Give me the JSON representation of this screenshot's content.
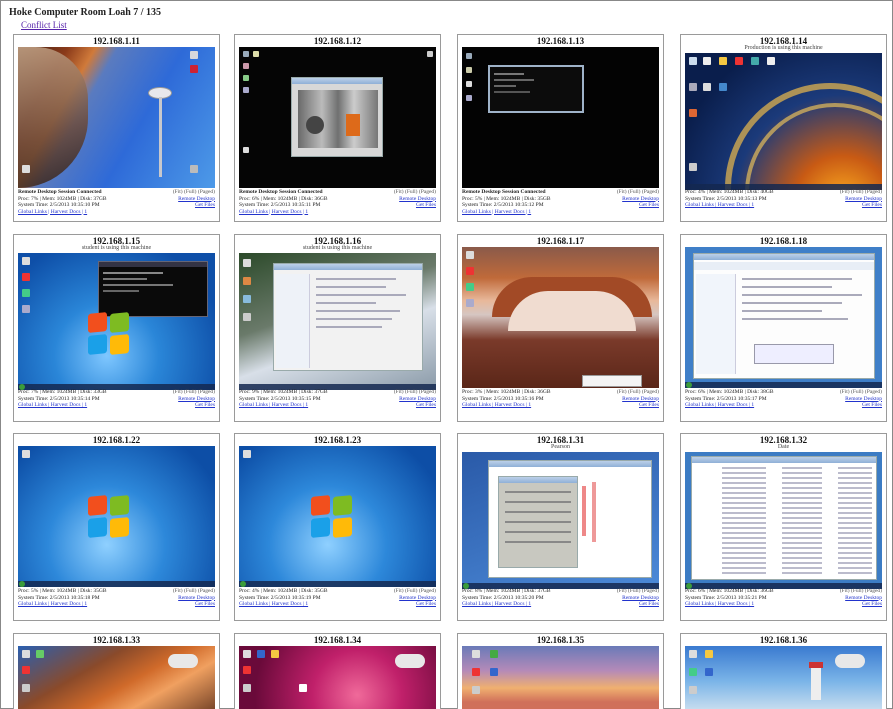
{
  "page": {
    "title": "Hoke Computer Room Loah 7 / 135",
    "link": "Conflict List"
  },
  "common": {
    "remote_link": "Remote Desktop",
    "files_link": "Get Files",
    "dim_line": "(Fit) (Full) (Paged)"
  },
  "cards": [
    {
      "ip": "192.168.1.11",
      "sub": "",
      "line1": "Remote Desktop Session Connected",
      "line2": "Proc: 7% | Mem: 1024MB | Disk: 37GB",
      "line3": "System Time: 2/5/2013 10:35:10 PM",
      "line4": "Global Links | Harvest Docs | 1"
    },
    {
      "ip": "192.168.1.12",
      "sub": "",
      "line1": "Remote Desktop Session Connected",
      "line2": "Proc: 6% | Mem: 1024MB | Disk: 36GB",
      "line3": "System Time: 2/5/2013 10:35:11 PM",
      "line4": "Global Links | Harvest Docs | 1"
    },
    {
      "ip": "192.168.1.13",
      "sub": "",
      "line1": "Remote Desktop Session Connected",
      "line2": "Proc: 5% | Mem: 1024MB | Disk: 35GB",
      "line3": "System Time: 2/5/2013 10:35:12 PM",
      "line4": "Global Links | Harvest Docs | 1"
    },
    {
      "ip": "192.168.1.14",
      "sub": "Production is using this machine",
      "line1": "",
      "line2": "Proc: 4% | Mem: 1024MB | Disk: 40GB",
      "line3": "System Time: 2/5/2013 10:35:13 PM",
      "line4": "Global Links | Harvest Docs | 1"
    },
    {
      "ip": "192.168.1.15",
      "sub": "student is using this machine",
      "line1": "",
      "line2": "Proc: 7% | Mem: 1024MB | Disk: 33GB",
      "line3": "System Time: 2/5/2013 10:35:14 PM",
      "line4": "Global Links | Harvest Docs | 1"
    },
    {
      "ip": "192.168.1.16",
      "sub": "student is using this machine",
      "line1": "",
      "line2": "Proc: 9% | Mem: 1024MB | Disk: 37GB",
      "line3": "System Time: 2/5/2013 10:35:15 PM",
      "line4": "Global Links | Harvest Docs | 1"
    },
    {
      "ip": "192.168.1.17",
      "sub": "",
      "line1": "",
      "line2": "Proc: 3% | Mem: 1024MB | Disk: 36GB",
      "line3": "System Time: 2/5/2013 10:35:16 PM",
      "line4": "Global Links | Harvest Docs | 1"
    },
    {
      "ip": "192.168.1.18",
      "sub": "",
      "line1": "",
      "line2": "Proc: 6% | Mem: 1024MB | Disk: 38GB",
      "line3": "System Time: 2/5/2013 10:35:17 PM",
      "line4": "Global Links | Harvest Docs | 1"
    },
    {
      "ip": "192.168.1.22",
      "sub": "",
      "line1": "",
      "line2": "Proc: 5% | Mem: 1024MB | Disk: 35GB",
      "line3": "System Time: 2/5/2013 10:35:18 PM",
      "line4": "Global Links | Harvest Docs | 1"
    },
    {
      "ip": "192.168.1.23",
      "sub": "",
      "line1": "",
      "line2": "Proc: 4% | Mem: 1024MB | Disk: 35GB",
      "line3": "System Time: 2/5/2013 10:35:19 PM",
      "line4": "Global Links | Harvest Docs | 1"
    },
    {
      "ip": "192.168.1.31",
      "sub": "Pearson",
      "line1": "",
      "line2": "Proc: 8% | Mem: 1024MB | Disk: 37GB",
      "line3": "System Time: 2/5/2013 10:35:20 PM",
      "line4": "Global Links | Harvest Docs | 1"
    },
    {
      "ip": "192.168.1.32",
      "sub": "Date",
      "line1": "",
      "line2": "Proc: 6% | Mem: 1024MB | Disk: 36GB",
      "line3": "System Time: 2/5/2013 10:35:21 PM",
      "line4": "Global Links | Harvest Docs | 1"
    },
    {
      "ip": "192.168.1.33",
      "sub": "",
      "line1": "",
      "line2": "",
      "line3": "",
      "line4": ""
    },
    {
      "ip": "192.168.1.34",
      "sub": "",
      "line1": "",
      "line2": "",
      "line3": "",
      "line4": ""
    },
    {
      "ip": "192.168.1.35",
      "sub": "",
      "line1": "",
      "line2": "",
      "line3": "",
      "line4": ""
    },
    {
      "ip": "192.168.1.36",
      "sub": "",
      "line1": "",
      "line2": "",
      "line3": "",
      "line4": ""
    }
  ]
}
